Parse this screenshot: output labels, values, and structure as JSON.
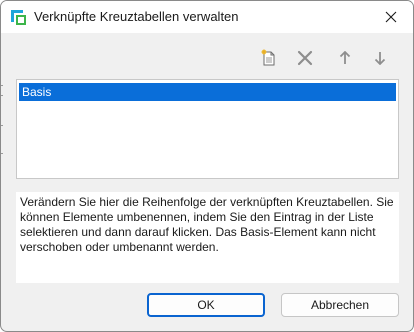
{
  "window": {
    "title": "Verknüpfte Kreuztabellen verwalten"
  },
  "toolbar": {
    "buttons": [
      {
        "icon": "new-document-icon",
        "enabled": true
      },
      {
        "icon": "delete-x-icon",
        "enabled": false
      },
      {
        "icon": "arrow-up-icon",
        "enabled": false
      },
      {
        "icon": "arrow-down-icon",
        "enabled": false
      }
    ]
  },
  "list": {
    "items": [
      {
        "label": "Basis",
        "selected": true
      }
    ]
  },
  "description": "Verändern Sie hier die Reihenfolge der verknüpften Kreuztabellen. Sie können Elemente umbenennen, indem Sie den Eintrag in der Liste selektieren und dann darauf klicken. Das Basis-Element kann nicht verschoben oder umbenannt werden.",
  "buttons": {
    "ok_label": "OK",
    "cancel_label": "Abbrechen"
  },
  "colors": {
    "selection": "#0a6ed9",
    "accent_border": "#0a64d0",
    "disabled_icon": "#8e8e8e"
  }
}
